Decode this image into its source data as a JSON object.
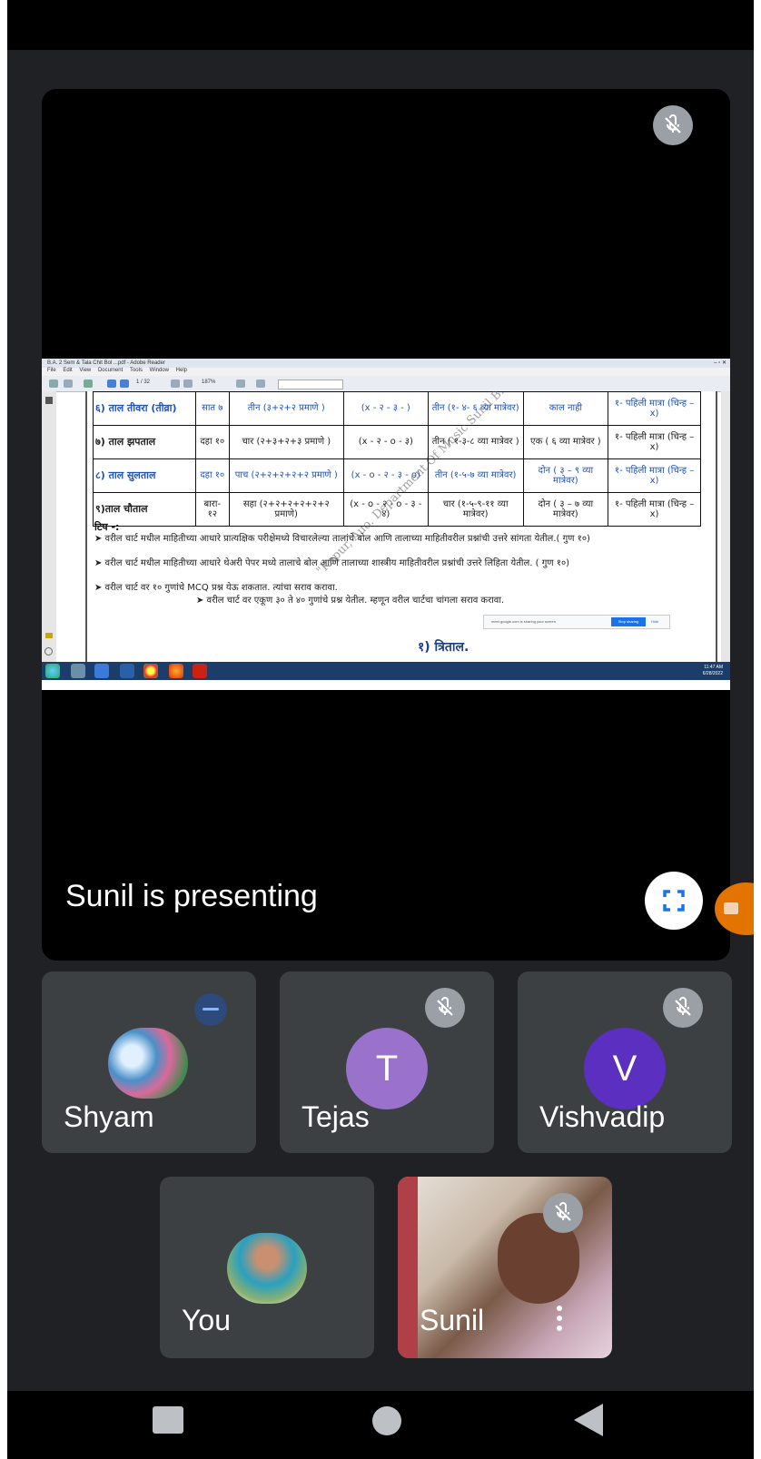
{
  "stage": {
    "presenting_label": "Sunil is presenting",
    "share": {
      "window_title": "B.A. 2 Sem & Tala Chit Bol ...pdf - Adobe Reader",
      "window_controls": "– ▫ ✕",
      "menu": [
        "File",
        "Edit",
        "View",
        "Document",
        "Tools",
        "Window",
        "Help"
      ],
      "toolbar_page": "1 / 32",
      "toolbar_zoom": "187%",
      "table_rows": [
        {
          "name": "६) ताल तीवरा (तीव्रा)",
          "matra": "सात ७",
          "vibhag": "तीन (३+२+२ प्रमाणे )",
          "tali": "(x - २ - ३ - )",
          "tali_count": "तीन (१- ४- ६ व्या मात्रेवर)",
          "khali": "काल नाही",
          "sam": "१- पहिली मात्रा (चिन्ह – x)",
          "blue": true
        },
        {
          "name": "७) ताल झपताल",
          "matra": "दहा १०",
          "vibhag": "चार (२+३+२+३ प्रमाणे )",
          "tali": "(x - २ - o - ३)",
          "tali_count": "तीन ( १-३-८ व्या मात्रेवर )",
          "khali": "एक ( ६ व्या मात्रेवर )",
          "sam": "१- पहिली मात्रा (चिन्ह – x)",
          "blue": false
        },
        {
          "name": "८) ताल सुलताल",
          "matra": "दहा १०",
          "vibhag": "पाच (२+२+२+२+२ प्रमाणे )",
          "tali": "(x - o - २ - ३ - o)",
          "tali_count": "तीन (१-५-७ व्या मात्रेवर)",
          "khali": "दोन ( ३ – ९ व्या मात्रेवर)",
          "sam": "१- पहिली मात्रा (चिन्ह – x)",
          "blue": true
        },
        {
          "name": "९)ताल चौताल",
          "matra": "बारा- १२",
          "vibhag": "सहा (२+२+२+२+२+२ प्रमाणे)",
          "tali": "(x - o - २ - o - ३ - ४)",
          "tali_count": "चार (१-५-९-११ व्या मात्रेवर)",
          "khali": "दोन ( ३ – ७ व्या मात्रेवर)",
          "sam": "१- पहिली मात्रा (चिन्ह – x)",
          "blue": false
        }
      ],
      "tip_title": "टिप -:",
      "tips": [
        "➤ वरील चार्ट मधील माहितीच्या आधारे प्रात्यक्षिक परीक्षेमध्ये विचारलेल्या तालांचे बोल आणि तालाच्या माहितीवरील प्रश्नांची उत्तरे सांगता येतील.( गुण १०)",
        "➤ वरील चार्ट मधील माहितीच्या आधारे थेअरी पेपर मध्ये तालाचे बोल आणि तालाच्या शास्त्रीय माहितीवरील प्रश्नांची उत्तरे लिहिता येतील. ( गुण १०)",
        "➤ वरील चार्ट वर १० गुणांचे MCQ प्रश्न येऊ शकतात. त्यांचा सराव करावा.",
        "➤ वरील चार्ट वर एकूण ३० ते ४० गुणांचे प्रश्न येतील. म्हणून वरील चार्टचा चांगला सराव करावा."
      ],
      "watermark": "\"Kapur, Auo. Department Of Music Sunil B. Patake",
      "section_heading": "१) त्रिताल.",
      "sharing_bar": {
        "text": "meet.google.com is sharing your screen.",
        "stop_label": "Stop sharing",
        "hide_label": "Hide"
      },
      "clock_time": "11:47 AM",
      "clock_date": "6/28/2022"
    }
  },
  "tiles": {
    "shyam": {
      "name": "Shyam"
    },
    "tejas": {
      "name": "Tejas",
      "initial": "T",
      "color": "#9b72cb"
    },
    "vishvadip": {
      "name": "Vishvadip",
      "initial": "V",
      "color": "#5b2fbf"
    },
    "you": {
      "name": "You"
    },
    "sunil": {
      "name": "Sunil"
    }
  },
  "icons": {
    "mic_off": "mic-off-icon",
    "fullscreen": "fullscreen-icon",
    "more": "more-vert-icon",
    "nav_recents": "square",
    "nav_home": "circle",
    "nav_back": "triangle"
  },
  "colors": {
    "background": "#202124",
    "tile": "#3c4043",
    "mic_badge": "#9aa0a6",
    "accent": "#1a73e8",
    "orange": "#e37400"
  }
}
